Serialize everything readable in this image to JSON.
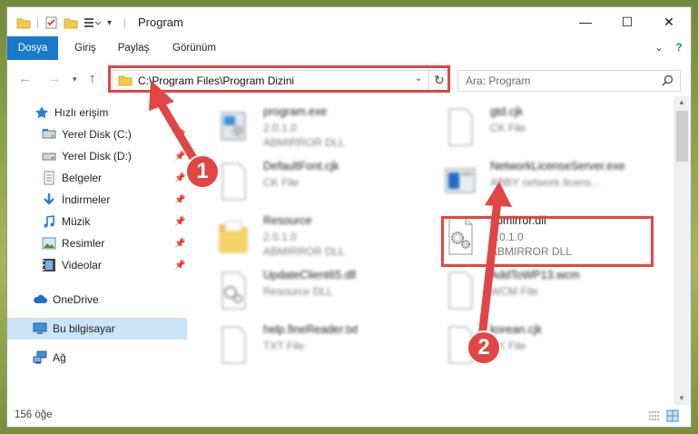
{
  "window": {
    "title": "Program",
    "minimize": "—",
    "maximize": "☐",
    "close": "✕"
  },
  "ribbon": {
    "tabs": [
      {
        "label": "Dosya"
      },
      {
        "label": "Giriş"
      },
      {
        "label": "Paylaş"
      },
      {
        "label": "Görünüm"
      }
    ],
    "expand_icon": "⌄",
    "help_icon": "?"
  },
  "nav": {
    "address": "C:\\Program Files\\Program Dizini",
    "search_placeholder": "Ara: Program"
  },
  "sidebar": {
    "items": [
      {
        "label": "Hızlı erişim",
        "icon": "star-icon"
      },
      {
        "label": "Yerel Disk (C:)",
        "icon": "drive-icon"
      },
      {
        "label": "Yerel Disk (D:)",
        "icon": "drive-icon"
      },
      {
        "label": "Belgeler",
        "icon": "documents-icon"
      },
      {
        "label": "İndirmeler",
        "icon": "download-icon"
      },
      {
        "label": "Müzik",
        "icon": "music-icon"
      },
      {
        "label": "Resimler",
        "icon": "pictures-icon"
      },
      {
        "label": "Videolar",
        "icon": "videos-icon"
      },
      {
        "label": "OneDrive",
        "icon": "cloud-icon"
      },
      {
        "label": "Bu bilgisayar",
        "icon": "computer-icon"
      },
      {
        "label": "Ağ",
        "icon": "network-icon"
      }
    ]
  },
  "files": {
    "left": [
      {
        "name": "program.exe",
        "line2": "2.0.1.0",
        "line3": "ABMIRROR DLL"
      },
      {
        "name": "DefaultFont.cjk",
        "line2": "CK File",
        "line3": ""
      },
      {
        "name": "Resource",
        "line2": "2.0.1.0",
        "line3": "ABMIRROR DLL"
      },
      {
        "name": "UpdateClient65.dll",
        "line2": "Resource DLL",
        "line3": ""
      },
      {
        "name": "help.fineReader.txt",
        "line2": "TXT File",
        "line3": ""
      }
    ],
    "right": [
      {
        "name": "gtd.cjk",
        "line2": "CK File",
        "line3": ""
      },
      {
        "name": "NetworkLicenseServer.exe",
        "line2": "ABBY network licens...",
        "line3": ""
      },
      {
        "name": "abmirror.dll",
        "line2": "2.0.1.0",
        "line3": "ABMIRROR DLL"
      },
      {
        "name": "AddToWP13.wcm",
        "line2": "WCM File",
        "line3": ""
      },
      {
        "name": "korean.cjk",
        "line2": "CK File",
        "line3": ""
      }
    ]
  },
  "annotations": {
    "badge1": "1",
    "badge2": "2",
    "color": "#e04646"
  },
  "status": {
    "count": "156 öğe"
  }
}
